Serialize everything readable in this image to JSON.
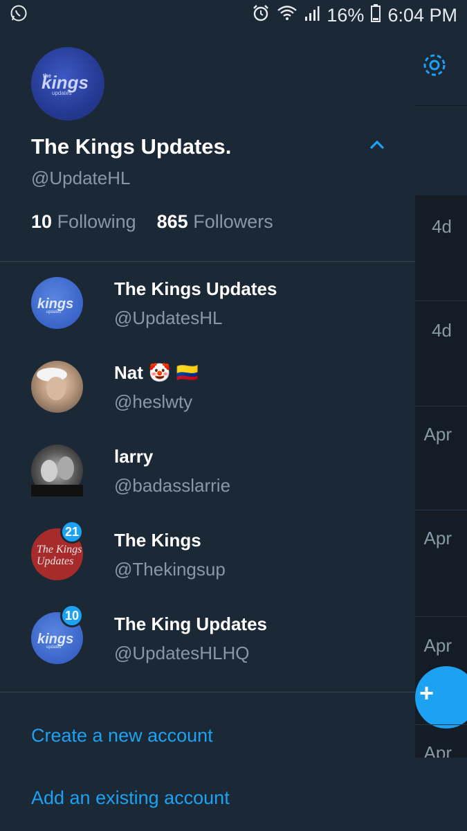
{
  "status_bar": {
    "app_icon": "whatsapp-icon",
    "battery": "16%",
    "time": "6:04 PM"
  },
  "behind": {
    "times": [
      "4d",
      "4d",
      "Apr",
      "Apr",
      "Apr",
      "Apr"
    ]
  },
  "profile": {
    "name": "The Kings Updates.",
    "handle": "@UpdateHL",
    "following_count": "10",
    "following_label": "Following",
    "followers_count": "865",
    "followers_label": "Followers"
  },
  "accounts": [
    {
      "name": "The Kings Updates",
      "handle": "@UpdatesHL",
      "badge": ""
    },
    {
      "name": "Nat",
      "handle": "@heslwty",
      "badge": "",
      "emoji": "🤡 🇨🇴"
    },
    {
      "name": "larry",
      "handle": "@badasslarrie",
      "badge": ""
    },
    {
      "name": "The Kings",
      "handle": "@Thekingsup",
      "badge": "21"
    },
    {
      "name": "The King Updates",
      "handle": "@UpdatesHLHQ",
      "badge": "10"
    }
  ],
  "actions": {
    "create": "Create a new account",
    "add": "Add an existing account"
  },
  "colors": {
    "accent": "#1da1f2",
    "drawer_bg": "#1b2836",
    "secondary_text": "#8899a6"
  }
}
